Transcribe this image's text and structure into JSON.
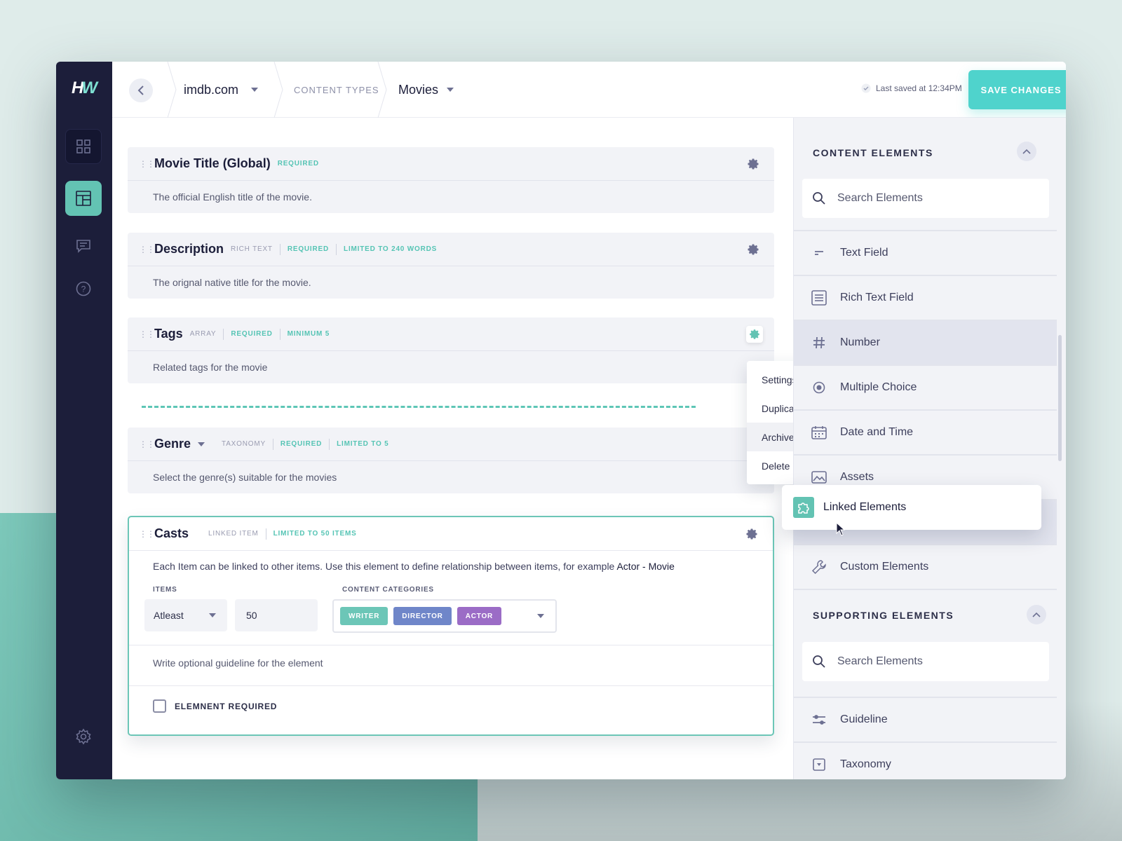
{
  "app": {
    "logo_text": "HW"
  },
  "header": {
    "site": "imdb.com",
    "section": "CONTENT TYPES",
    "content_type": "Movies",
    "last_saved": "Last saved at 12:34PM",
    "save_label": "SAVE CHANGES"
  },
  "fields": [
    {
      "title": "Movie Title (Global)",
      "tags": [
        "REQUIRED"
      ],
      "description": "The official English title of the movie."
    },
    {
      "title": "Description",
      "tags": [
        "RICH TEXT",
        "REQUIRED",
        "LIMITED TO 240 WORDS"
      ],
      "description": "The orignal native title for the movie."
    },
    {
      "title": "Tags",
      "tags": [
        "ARRAY",
        "REQUIRED",
        "MINIMUM 5"
      ],
      "description": "Related tags for the movie"
    },
    {
      "title": "Genre",
      "tags": [
        "TAXONOMY",
        "REQUIRED",
        "LIMITED TO 5"
      ],
      "description": "Select the genre(s) suitable for the movies"
    }
  ],
  "context_menu": [
    "Settings",
    "Duplicate",
    "Archive",
    "Delete"
  ],
  "casts": {
    "title": "Casts",
    "tags": [
      "LINKED ITEM",
      "LIMITED TO 50 ITEMS"
    ],
    "description": "Each Item can be linked to other items. Use this element to define relationship between items, for example",
    "example": "Actor - Movie",
    "items_label": "ITEMS",
    "items_mode": "Atleast",
    "items_count": "50",
    "categories_label": "CONTENT CATEGORIES",
    "categories": [
      {
        "label": "WRITER",
        "color": "#6cc6b7"
      },
      {
        "label": "DIRECTOR",
        "color": "#6f86c9"
      },
      {
        "label": "ACTOR",
        "color": "#9b6cc6"
      }
    ],
    "guideline_placeholder": "Write optional guideline for the element",
    "required_label": "ELEMNENT REQUIRED"
  },
  "panel": {
    "content_heading": "CONTENT ELEMENTS",
    "search_placeholder": "Search Elements",
    "content_items": [
      {
        "label": "Text Field",
        "icon": "text-field-icon"
      },
      {
        "label": "Rich Text Field",
        "icon": "rich-text-icon"
      },
      {
        "label": "Number",
        "icon": "hash-icon"
      },
      {
        "label": "Multiple Choice",
        "icon": "radio-icon"
      },
      {
        "label": "Date and Time",
        "icon": "calendar-icon"
      },
      {
        "label": "Assets",
        "icon": "image-icon"
      },
      {
        "label": "Custom Elements",
        "icon": "wrench-icon"
      }
    ],
    "supporting_heading": "SUPPORTING ELEMENTS",
    "supporting_items": [
      {
        "label": "Guideline",
        "icon": "sliders-icon"
      },
      {
        "label": "Taxonomy",
        "icon": "dropdown-icon"
      }
    ],
    "dragging": {
      "label": "Linked Elements",
      "icon": "puzzle-icon"
    }
  },
  "colors": {
    "accent": "#4fd3cc",
    "sidebar": "#1c1e3a",
    "teal": "#63c3b3"
  }
}
